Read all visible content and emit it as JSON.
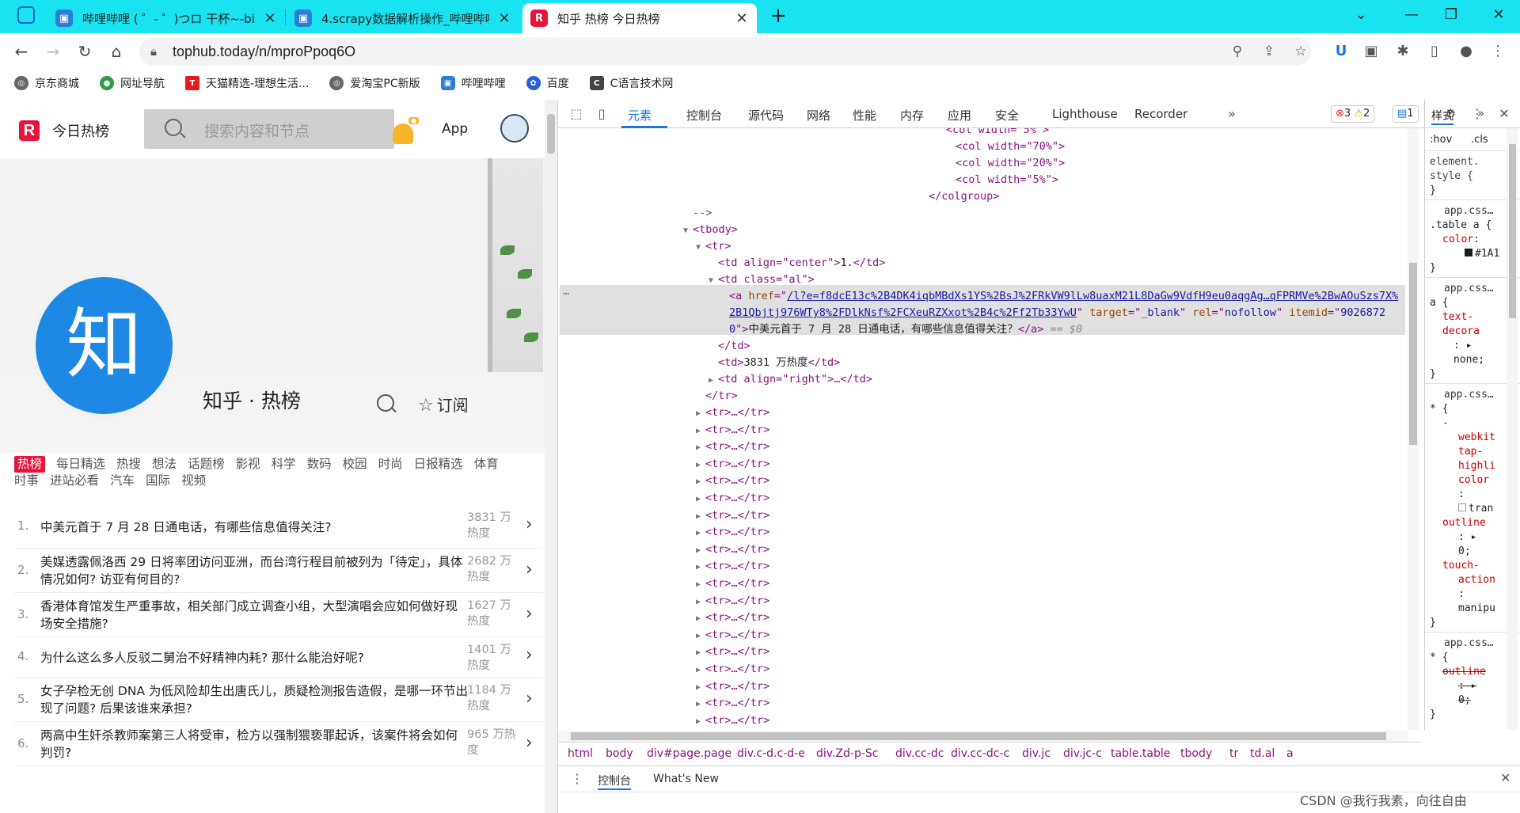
{
  "browser": {
    "tabs": [
      {
        "title": "哔哩哔哩 ( ゜- ゜)つロ 干杯~-bili",
        "icon": "bilibili-icon"
      },
      {
        "title": "4.scrapy数据解析操作_哔哩哔哩",
        "icon": "bilibili-icon"
      },
      {
        "title": "知乎 热榜 今日热榜",
        "icon": "tophub-icon"
      }
    ],
    "url": "tophub.today/n/mproPpoq6O",
    "bookmarks": [
      "京东商城",
      "网址导航",
      "天猫精选-理想生活...",
      "爱淘宝PC新版",
      "哔哩哔哩",
      "百度",
      "C语言技术网"
    ]
  },
  "site": {
    "logo_text": "今日热榜",
    "search_placeholder": "搜索内容和节点",
    "app_label": "App",
    "board_logo_char": "知",
    "board_title": "知乎 · 热榜",
    "subscribe_label": "订阅",
    "categories": [
      "热榜",
      "每日精选",
      "热搜",
      "想法",
      "话题榜",
      "影视",
      "科学",
      "数码",
      "校园",
      "时尚",
      "日报精选",
      "体育",
      "时事",
      "进站必看",
      "汽车",
      "国际",
      "视频"
    ],
    "hot_list": [
      {
        "rank": "1.",
        "q": "中美元首于 7 月 28 日通电话，有哪些信息值得关注?",
        "heat": "3831 万热度"
      },
      {
        "rank": "2.",
        "q": "美媒透露佩洛西 29 日将率团访问亚洲，而台湾行程目前被列为「待定」，具体情况如何? 访亚有何目的?",
        "heat": "2682 万热度"
      },
      {
        "rank": "3.",
        "q": "香港体育馆发生严重事故，相关部门成立调查小组，大型演唱会应如何做好现场安全措施?",
        "heat": "1627 万热度"
      },
      {
        "rank": "4.",
        "q": "为什么这么多人反驳二舅治不好精神内耗? 那什么能治好呢?",
        "heat": "1401 万热度"
      },
      {
        "rank": "5.",
        "q": "女子孕检无创 DNA 为低风险却生出唐氏儿，质疑检测报告造假，是哪一环节出现了问题? 后果该谁来承担?",
        "heat": "1184 万热度"
      },
      {
        "rank": "6.",
        "q": "两高中生奸杀教师案第三人将受审，检方以强制猥亵罪起诉，该案件将会如何判罚?",
        "heat": "965 万热度"
      }
    ]
  },
  "devtools": {
    "tabs": [
      "元素",
      "控制台",
      "源代码",
      "网络",
      "性能",
      "内存",
      "应用",
      "安全",
      "Lighthouse",
      "Recorder"
    ],
    "errors": "3",
    "warnings": "2",
    "messages": "1",
    "dom": {
      "col_partial": "<col width=\"5%\">",
      "col1": "<col width=\"70%\">",
      "col2": "<col width=\"20%\">",
      "col3": "<col width=\"5%\">",
      "colgroup_close": "</colgroup>",
      "comment_close": "-->",
      "tbody": "<tbody>",
      "tr": "<tr>",
      "td1_open": "<td align=\"center\">",
      "td1_text": "1.",
      "td_close": "</td>",
      "td2_open": "<td class=\"al\">",
      "a_href_line1": "/l?e=f8dcE13c%2B4DK4iqbMBdXs1YS%2BsJ%2FRkVW9lLw8uaxM21L8DaGw9VdfH9eu0aqgAg…qFPRMVe%2BwAOuSzs7X%",
      "a_href_line2": "2B1Qbjtj976WTy8%2FDlkNsf%2FCXeuRZXxot%2B4c%2Ff2Tb33YwU",
      "a_itemid_part": "9026872",
      "a_itemid_tail": "0",
      "a_text": "中美元首于 7 月 28 日通电话，有哪些信息值得关注？",
      "a_eq": "== $0",
      "td_heat_text": "3831 万热度",
      "td_right": "<td align=\"right\">…</td>",
      "tr_close": "</tr>",
      "tr_collapsed": "<tr>…</tr>"
    },
    "breadcrumbs": [
      "html",
      "body",
      "div#page.page",
      "div.c-d.c-d-e",
      "div.Zd-p-Sc",
      "div.cc-dc",
      "div.cc-dc-c",
      "div.jc",
      "div.jc-c",
      "table.table",
      "tbody",
      "tr",
      "td.al",
      "a"
    ],
    "styles_tab": "样式",
    "styles_filters": [
      ":hov",
      ".cls"
    ],
    "drawer_tabs": [
      "控制台",
      "What's New"
    ]
  },
  "watermark": "CSDN @我行我素，向往自由"
}
